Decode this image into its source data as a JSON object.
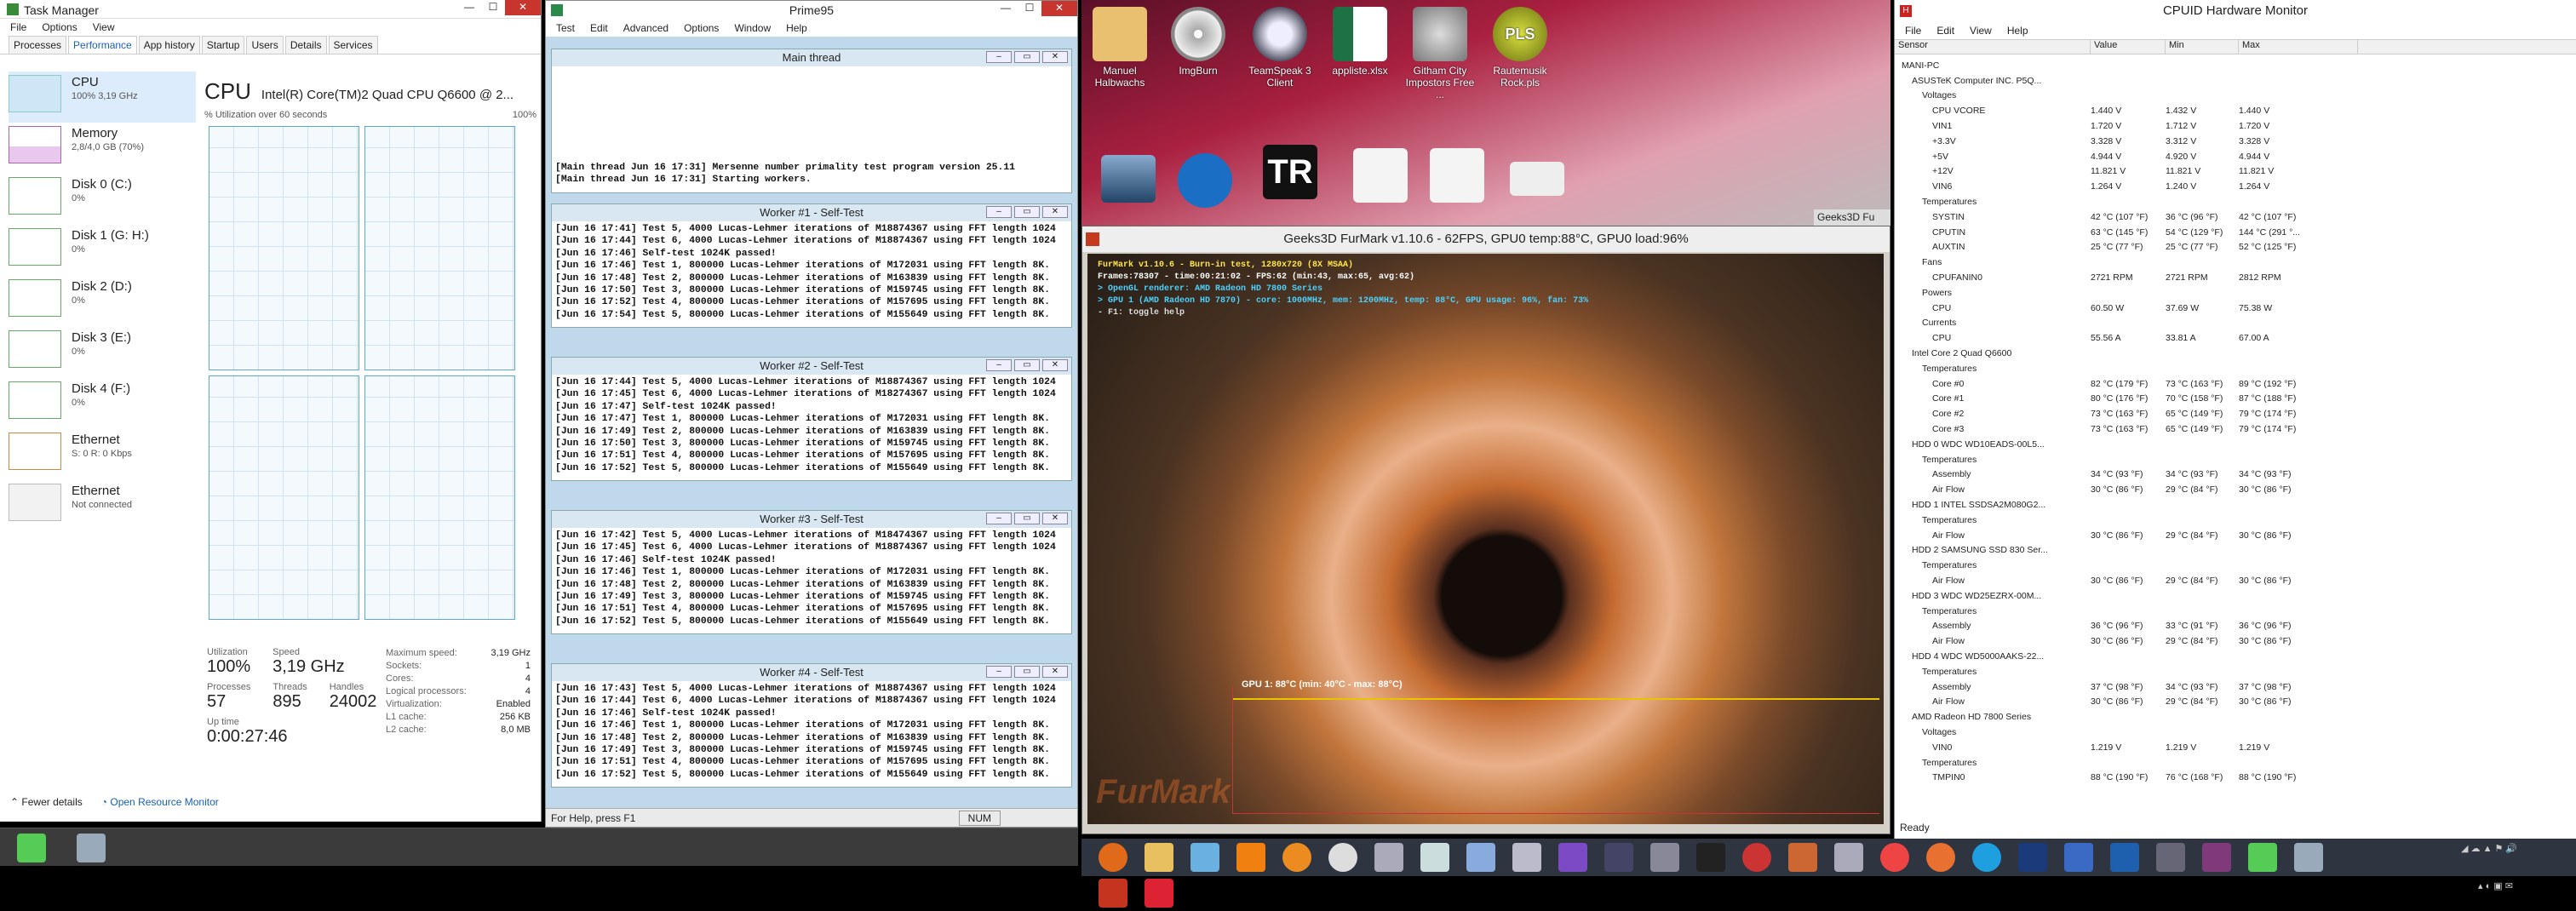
{
  "taskmanager": {
    "title": "Task Manager",
    "menu": [
      "File",
      "Options",
      "View"
    ],
    "tabs": [
      "Processes",
      "Performance",
      "App history",
      "Startup",
      "Users",
      "Details",
      "Services"
    ],
    "side": [
      {
        "name": "CPU",
        "sub": "100% 3,19 GHz"
      },
      {
        "name": "Memory",
        "sub": "2,8/4,0 GB (70%)"
      },
      {
        "name": "Disk 0 (C:)",
        "sub": "0%"
      },
      {
        "name": "Disk 1 (G: H:)",
        "sub": "0%"
      },
      {
        "name": "Disk 2 (D:)",
        "sub": "0%"
      },
      {
        "name": "Disk 3 (E:)",
        "sub": "0%"
      },
      {
        "name": "Disk 4 (F:)",
        "sub": "0%"
      },
      {
        "name": "Ethernet",
        "sub": "S: 0 R: 0 Kbps"
      },
      {
        "name": "Ethernet",
        "sub": "Not connected"
      }
    ],
    "cpu_title": "CPU",
    "cpu_name": "Intel(R) Core(TM)2 Quad CPU Q6600 @ 2...",
    "util_label": "% Utilization over 60 seconds",
    "util_max": "100%",
    "utilization_label": "Utilization",
    "utilization": "100%",
    "speed_label": "Speed",
    "speed": "3,19 GHz",
    "processes_label": "Processes",
    "processes": "57",
    "threads_label": "Threads",
    "threads": "895",
    "handles_label": "Handles",
    "handles": "24002",
    "uptime_label": "Up time",
    "uptime": "0:00:27:46",
    "specs": [
      [
        "Maximum speed:",
        "3,19 GHz"
      ],
      [
        "Sockets:",
        "1"
      ],
      [
        "Cores:",
        "4"
      ],
      [
        "Logical processors:",
        "4"
      ],
      [
        "Virtualization:",
        "Enabled"
      ],
      [
        "L1 cache:",
        "256 KB"
      ],
      [
        "L2 cache:",
        "8,0 MB"
      ]
    ],
    "fewer": "Fewer details",
    "monitor": "Open Resource Monitor"
  },
  "prime95": {
    "title": "Prime95",
    "menu": [
      "Test",
      "Edit",
      "Advanced",
      "Options",
      "Window",
      "Help"
    ],
    "main_title": "Main thread",
    "main_lines": [
      "[Main thread Jun 16 17:31] Mersenne number primality test program version 25.11",
      "[Main thread Jun 16 17:31] Starting workers."
    ],
    "workers": [
      {
        "title": "Worker #1 - Self-Test",
        "lines": [
          "[Jun 16 17:41] Test 5, 4000 Lucas-Lehmer iterations of M18874367 using FFT length 1024",
          "[Jun 16 17:44] Test 6, 4000 Lucas-Lehmer iterations of M18874367 using FFT length 1024",
          "[Jun 16 17:46] Self-test 1024K passed!",
          "[Jun 16 17:46] Test 1, 800000 Lucas-Lehmer iterations of M172031 using FFT length 8K.",
          "[Jun 16 17:48] Test 2, 800000 Lucas-Lehmer iterations of M163839 using FFT length 8K.",
          "[Jun 16 17:50] Test 3, 800000 Lucas-Lehmer iterations of M159745 using FFT length 8K.",
          "[Jun 16 17:52] Test 4, 800000 Lucas-Lehmer iterations of M157695 using FFT length 8K.",
          "[Jun 16 17:54] Test 5, 800000 Lucas-Lehmer iterations of M155649 using FFT length 8K."
        ]
      },
      {
        "title": "Worker #2 - Self-Test",
        "lines": [
          "[Jun 16 17:44] Test 5, 4000 Lucas-Lehmer iterations of M18874367 using FFT length 1024",
          "[Jun 16 17:45] Test 6, 4000 Lucas-Lehmer iterations of M18274367 using FFT length 1024",
          "[Jun 16 17:47] Self-test 1024K passed!",
          "[Jun 16 17:47] Test 1, 800000 Lucas-Lehmer iterations of M172031 using FFT length 8K.",
          "[Jun 16 17:49] Test 2, 800000 Lucas-Lehmer iterations of M163839 using FFT length 8K.",
          "[Jun 16 17:50] Test 3, 800000 Lucas-Lehmer iterations of M159745 using FFT length 8K.",
          "[Jun 16 17:51] Test 4, 800000 Lucas-Lehmer iterations of M157695 using FFT length 8K.",
          "[Jun 16 17:52] Test 5, 800000 Lucas-Lehmer iterations of M155649 using FFT length 8K."
        ]
      },
      {
        "title": "Worker #3 - Self-Test",
        "lines": [
          "[Jun 16 17:42] Test 5, 4000 Lucas-Lehmer iterations of M18474367 using FFT length 1024",
          "[Jun 16 17:45] Test 6, 4000 Lucas-Lehmer iterations of M18874367 using FFT length 1024",
          "[Jun 16 17:46] Self-test 1024K passed!",
          "[Jun 16 17:46] Test 1, 800000 Lucas-Lehmer iterations of M172031 using FFT length 8K.",
          "[Jun 16 17:48] Test 2, 800000 Lucas-Lehmer iterations of M163839 using FFT length 8K.",
          "[Jun 16 17:49] Test 3, 800000 Lucas-Lehmer iterations of M159745 using FFT length 8K.",
          "[Jun 16 17:51] Test 4, 800000 Lucas-Lehmer iterations of M157695 using FFT length 8K.",
          "[Jun 16 17:52] Test 5, 800000 Lucas-Lehmer iterations of M155649 using FFT length 8K."
        ]
      },
      {
        "title": "Worker #4 - Self-Test",
        "lines": [
          "[Jun 16 17:43] Test 5, 4000 Lucas-Lehmer iterations of M18874367 using FFT length 1024",
          "[Jun 16 17:44] Test 6, 4000 Lucas-Lehmer iterations of M18874367 using FFT length 1024",
          "[Jun 16 17:46] Self-test 1024K passed!",
          "[Jun 16 17:46] Test 1, 800000 Lucas-Lehmer iterations of M172031 using FFT length 8K.",
          "[Jun 16 17:48] Test 2, 800000 Lucas-Lehmer iterations of M163839 using FFT length 8K.",
          "[Jun 16 17:49] Test 3, 800000 Lucas-Lehmer iterations of M159745 using FFT length 8K.",
          "[Jun 16 17:51] Test 4, 800000 Lucas-Lehmer iterations of M157695 using FFT length 8K.",
          "[Jun 16 17:52] Test 5, 800000 Lucas-Lehmer iterations of M155649 using FFT length 8K."
        ]
      }
    ],
    "status": "For Help, press F1",
    "num": "NUM"
  },
  "desktop": {
    "icons": [
      "Manuel Halbwachs",
      "ImgBurn",
      "TeamSpeak 3 Client",
      "appliste.xlsx",
      "Githam City Impostors Free ...",
      "Rautemusik Rock.pls"
    ],
    "geeks3d": "Geeks3D Fu"
  },
  "furmark": {
    "title": "Geeks3D FurMark v1.10.6 - 62FPS, GPU0 temp:88°C, GPU0 load:96%",
    "lines": [
      "FurMark v1.10.6 - Burn-in test, 1280x720 (8X MSAA)",
      "Frames:78307 - time:00:21:02 - FPS:62 (min:43, max:65, avg:62)",
      "> OpenGL renderer: AMD Radeon HD 7800 Series",
      "> GPU 1 (AMD Radeon HD 7870) - core: 1000MHz, mem: 1200MHz, temp: 88°C, GPU usage: 96%, fan: 73%",
      "- F1: toggle help"
    ],
    "gpu_graph": "GPU 1: 88°C (min: 40°C - max: 88°C)",
    "logo": "FurMark"
  },
  "hwmon": {
    "title": "CPUID Hardware Monitor",
    "menu": [
      "File",
      "Edit",
      "View",
      "Help"
    ],
    "columns": [
      "Sensor",
      "Value",
      "Min",
      "Max"
    ],
    "rows": [
      [
        "MANI-PC",
        "",
        "",
        ""
      ],
      [
        "ASUSTeK Computer INC. P5Q...",
        "",
        "",
        ""
      ],
      [
        "Voltages",
        "",
        "",
        ""
      ],
      [
        "CPU VCORE",
        "1.440 V",
        "1.432 V",
        "1.440 V"
      ],
      [
        "VIN1",
        "1.720 V",
        "1.712 V",
        "1.720 V"
      ],
      [
        "+3.3V",
        "3.328 V",
        "3.312 V",
        "3.328 V"
      ],
      [
        "+5V",
        "4.944 V",
        "4.920 V",
        "4.944 V"
      ],
      [
        "+12V",
        "11.821 V",
        "11.821 V",
        "11.821 V"
      ],
      [
        "VIN6",
        "1.264 V",
        "1.240 V",
        "1.264 V"
      ],
      [
        "Temperatures",
        "",
        "",
        ""
      ],
      [
        "SYSTIN",
        "42 °C  (107 °F)",
        "36 °C  (96 °F)",
        "42 °C  (107 °F)"
      ],
      [
        "CPUTIN",
        "63 °C  (145 °F)",
        "54 °C  (129 °F)",
        "144 °C  (291 °..."
      ],
      [
        "AUXTIN",
        "25 °C  (77 °F)",
        "25 °C  (77 °F)",
        "52 °C  (125 °F)"
      ],
      [
        "Fans",
        "",
        "",
        ""
      ],
      [
        "CPUFANIN0",
        "2721 RPM",
        "2721 RPM",
        "2812 RPM"
      ],
      [
        "Powers",
        "",
        "",
        ""
      ],
      [
        "CPU",
        "60.50 W",
        "37.69 W",
        "75.38 W"
      ],
      [
        "Currents",
        "",
        "",
        ""
      ],
      [
        "CPU",
        "55.56 A",
        "33.81 A",
        "67.00 A"
      ],
      [
        "Intel Core 2 Quad Q6600",
        "",
        "",
        ""
      ],
      [
        "Temperatures",
        "",
        "",
        ""
      ],
      [
        "Core #0",
        "82 °C  (179 °F)",
        "73 °C  (163 °F)",
        "89 °C  (192 °F)"
      ],
      [
        "Core #1",
        "80 °C  (176 °F)",
        "70 °C  (158 °F)",
        "87 °C  (188 °F)"
      ],
      [
        "Core #2",
        "73 °C  (163 °F)",
        "65 °C  (149 °F)",
        "79 °C  (174 °F)"
      ],
      [
        "Core #3",
        "73 °C  (163 °F)",
        "65 °C  (149 °F)",
        "79 °C  (174 °F)"
      ],
      [
        "HDD 0 WDC WD10EADS-00L5...",
        "",
        "",
        ""
      ],
      [
        "Temperatures",
        "",
        "",
        ""
      ],
      [
        "Assembly",
        "34 °C  (93 °F)",
        "34 °C  (93 °F)",
        "34 °C  (93 °F)"
      ],
      [
        "Air Flow",
        "30 °C  (86 °F)",
        "29 °C  (84 °F)",
        "30 °C  (86 °F)"
      ],
      [
        "HDD 1 INTEL SSDSA2M080G2...",
        "",
        "",
        ""
      ],
      [
        "Temperatures",
        "",
        "",
        ""
      ],
      [
        "Air Flow",
        "30 °C  (86 °F)",
        "29 °C  (84 °F)",
        "30 °C  (86 °F)"
      ],
      [
        "HDD 2 SAMSUNG SSD 830 Ser...",
        "",
        "",
        ""
      ],
      [
        "Temperatures",
        "",
        "",
        ""
      ],
      [
        "Air Flow",
        "30 °C  (86 °F)",
        "29 °C  (84 °F)",
        "30 °C  (86 °F)"
      ],
      [
        "HDD 3 WDC WD25EZRX-00M...",
        "",
        "",
        ""
      ],
      [
        "Temperatures",
        "",
        "",
        ""
      ],
      [
        "Assembly",
        "36 °C  (96 °F)",
        "33 °C  (91 °F)",
        "36 °C  (96 °F)"
      ],
      [
        "Air Flow",
        "30 °C  (86 °F)",
        "29 °C  (84 °F)",
        "30 °C  (86 °F)"
      ],
      [
        "HDD 4 WDC WD5000AAKS-22...",
        "",
        "",
        ""
      ],
      [
        "Temperatures",
        "",
        "",
        ""
      ],
      [
        "Assembly",
        "37 °C  (98 °F)",
        "34 °C  (93 °F)",
        "37 °C  (98 °F)"
      ],
      [
        "Air Flow",
        "30 °C  (86 °F)",
        "29 °C  (84 °F)",
        "30 °C  (86 °F)"
      ],
      [
        "AMD Radeon HD 7800 Series",
        "",
        "",
        ""
      ],
      [
        "Voltages",
        "",
        "",
        ""
      ],
      [
        "VIN0",
        "1.219 V",
        "1.219 V",
        "1.219 V"
      ],
      [
        "Temperatures",
        "",
        "",
        ""
      ],
      [
        "TMPIN0",
        "88 °C  (190 °F)",
        "76 °C  (168 °F)",
        "88 °C  (190 °F)"
      ]
    ],
    "indent": [
      0,
      1,
      2,
      3,
      3,
      3,
      3,
      3,
      3,
      2,
      3,
      3,
      3,
      2,
      3,
      2,
      3,
      2,
      3,
      1,
      2,
      3,
      3,
      3,
      3,
      1,
      2,
      3,
      3,
      1,
      2,
      3,
      1,
      2,
      3,
      1,
      2,
      3,
      3,
      1,
      2,
      3,
      3,
      1,
      2,
      3,
      2,
      3
    ],
    "status": "Ready"
  }
}
